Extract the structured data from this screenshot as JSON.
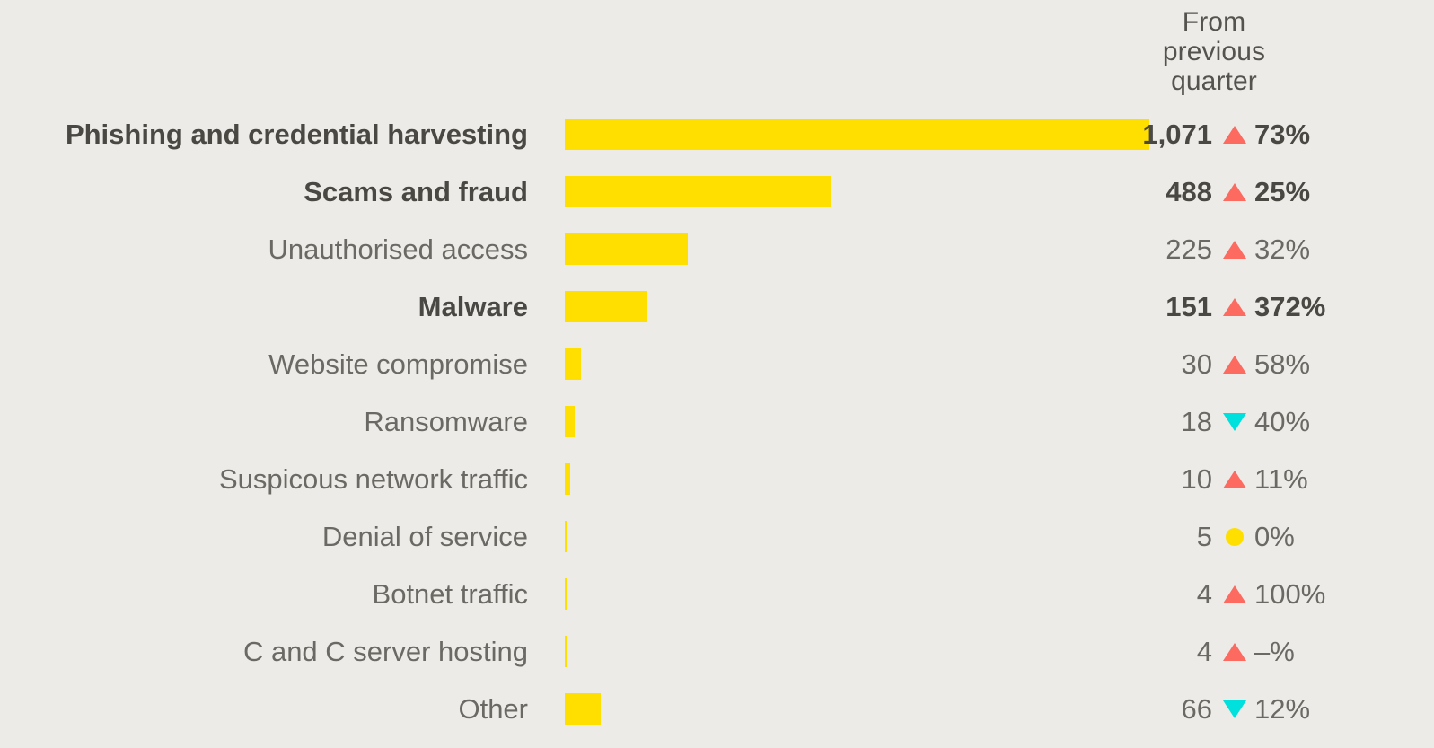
{
  "header": {
    "delta_column_lines": [
      "From",
      "previous",
      "quarter"
    ]
  },
  "colors": {
    "background": "#ECEBE7",
    "bar": "#FFDF00",
    "increase": "#FC6A60",
    "decrease": "#00E0DC",
    "flat": "#FFDF00",
    "text_regular": "#6B6963",
    "text_emphasis": "#4A4843"
  },
  "chart_data": {
    "type": "bar",
    "title": "",
    "xlabel": "",
    "ylabel": "",
    "orientation": "horizontal",
    "grid": false,
    "legend": "none",
    "xlim": [
      0,
      1071
    ],
    "categories": [
      "Phishing and credential harvesting",
      "Scams and fraud",
      "Unauthorised access",
      "Malware",
      "Website compromise",
      "Ransomware",
      "Suspicous network traffic",
      "Denial of service",
      "Botnet traffic",
      "C and C server hosting",
      "Other"
    ],
    "values": [
      1071,
      488,
      225,
      151,
      30,
      18,
      10,
      5,
      4,
      4,
      66
    ],
    "value_labels": [
      "1,071",
      "488",
      "225",
      "151",
      "30",
      "18",
      "10",
      "5",
      "4",
      "4",
      "66"
    ],
    "deltas": [
      "73%",
      "25%",
      "32%",
      "372%",
      "58%",
      "40%",
      "11%",
      "0%",
      "100%",
      "–%",
      "12%"
    ],
    "delta_directions": [
      "up",
      "up",
      "up",
      "up",
      "up",
      "down",
      "up",
      "flat",
      "up",
      "up",
      "down"
    ],
    "emphasis": [
      true,
      true,
      false,
      true,
      false,
      false,
      false,
      false,
      false,
      false,
      false
    ]
  }
}
